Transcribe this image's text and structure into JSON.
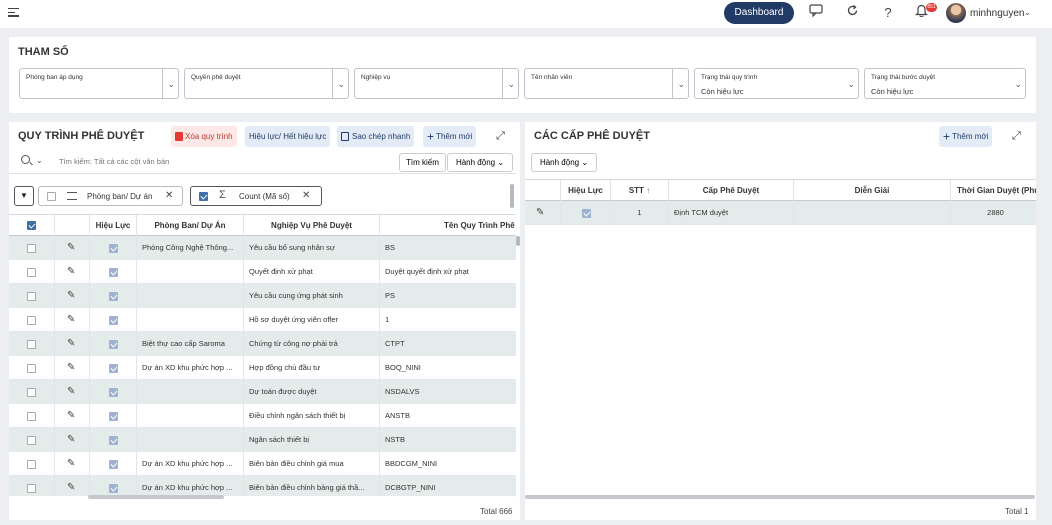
{
  "topbar": {
    "dashboard_label": "Dashboard",
    "help_icon": "?",
    "notification_count": "851",
    "username": "minhnguyen"
  },
  "params": {
    "title": "THAM SỐ",
    "fields": [
      {
        "label": "Phòng ban áp dụng",
        "value": ""
      },
      {
        "label": "Quyền phê duyệt",
        "value": ""
      },
      {
        "label": "Nghiệp vụ",
        "value": ""
      },
      {
        "label": "Tên nhân viên",
        "value": ""
      },
      {
        "label": "Trạng thái quy trình",
        "value": "Còn hiệu lực"
      },
      {
        "label": "Trạng thái bước duyệt",
        "value": "Còn hiệu lực"
      }
    ]
  },
  "left_panel": {
    "title": "QUY TRÌNH PHÊ DUYỆT",
    "delete_label": "Xóa quy trình",
    "toggle_label": "Hiệu lực/ Hết hiệu lực",
    "copy_label": "Sao chép nhanh",
    "add_label": "Thêm mới",
    "search_placeholder": "Tìm kiếm: Tất cả các cột văn bản",
    "search_button": "Tìm kiếm",
    "action_button": "Hành động",
    "group_chip": "Phòng ban/ Dự án",
    "count_chip": "Count (Mã số)",
    "columns": [
      "Hiệu Lực",
      "Phòng Ban/ Dự Án",
      "Nghiệp Vụ Phê Duyệt",
      "Tên Quy Trình Phê Duyệt"
    ],
    "rows": [
      {
        "dept": "Phòng Công Nghệ Thông...",
        "task": "Yêu cầu bổ sung nhân sự",
        "name": "BS"
      },
      {
        "dept": "",
        "task": "Quyết định xử phạt",
        "name": "Duyệt quyết định xử phạt"
      },
      {
        "dept": "",
        "task": "Yêu cầu cung ứng phát sinh",
        "name": "PS"
      },
      {
        "dept": "",
        "task": "Hồ sơ duyệt ứng viên offer",
        "name": "1"
      },
      {
        "dept": "Biệt thự cao cấp Saroma",
        "task": "Chứng từ công nợ phải trả",
        "name": "CTPT"
      },
      {
        "dept": "Dự án XD khu phức hợp ...",
        "task": "Hợp đồng chủ đầu tư",
        "name": "BOQ_NINI"
      },
      {
        "dept": "",
        "task": "Dự toán được duyệt",
        "name": "NSDALVS"
      },
      {
        "dept": "",
        "task": "Điều chỉnh ngân sách thiết bị",
        "name": "ANSTB"
      },
      {
        "dept": "",
        "task": "Ngân sách thiết bị",
        "name": "NSTB"
      },
      {
        "dept": "Dự án XD khu phức hợp ...",
        "task": "Biên bản điều chỉnh giá mua",
        "name": "BBDCGM_NINI"
      },
      {
        "dept": "Dự án XD khu phức hợp ...",
        "task": "Biên bản điều chỉnh bảng giá thầ...",
        "name": "DCBGTP_NINI"
      }
    ],
    "total": "Total 666"
  },
  "right_panel": {
    "title": "CÁC CẤP PHÊ DUYỆT",
    "add_label": "Thêm mới",
    "action_button": "Hành động",
    "columns": [
      "Hiệu Lực",
      "STT",
      "Cấp Phê Duyệt",
      "Diễn Giải",
      "Thời Gian Duyệt (Phút)"
    ],
    "rows": [
      {
        "stt": "1",
        "level": "Định TCM duyệt",
        "desc": "",
        "time": "2880"
      }
    ],
    "total": "Total 1"
  },
  "colors": {
    "navy": "#223b66",
    "row_alt": "#e3ecea",
    "checkbox": "#3f6ea8",
    "delete_bg": "#fde8e8",
    "chip_bg": "#e3ebf6"
  },
  "icons": [
    "hamburger-icon",
    "chat-icon",
    "refresh-icon",
    "help-icon",
    "bell-icon",
    "search-icon",
    "sigma-icon",
    "edit-pencil-icon",
    "expand-icon",
    "plus-icon",
    "trash-icon",
    "copy-icon"
  ]
}
